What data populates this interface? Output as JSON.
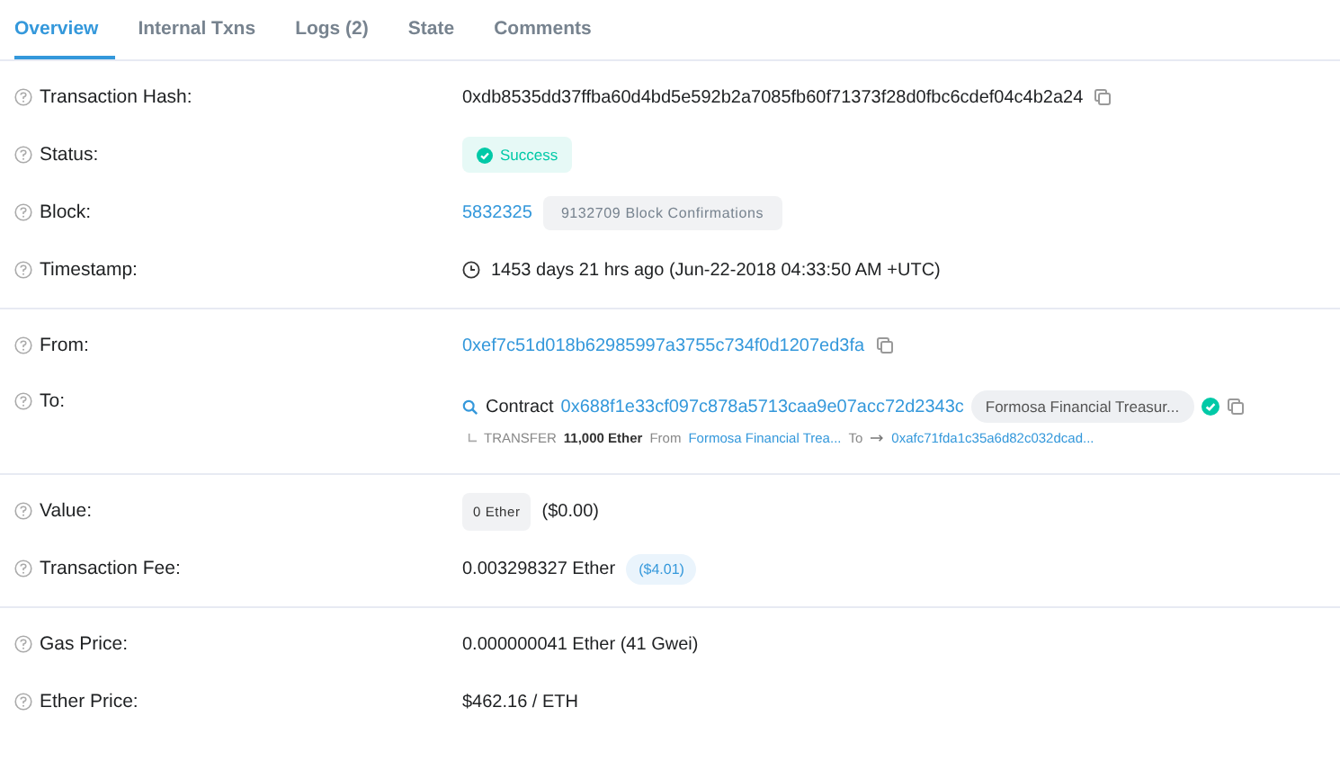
{
  "tabs": [
    {
      "label": "Overview",
      "selected": true
    },
    {
      "label": "Internal Txns",
      "selected": false
    },
    {
      "label": "Logs (2)",
      "selected": false
    },
    {
      "label": "State",
      "selected": false
    },
    {
      "label": "Comments",
      "selected": false
    }
  ],
  "sections": [
    {
      "rows": [
        {
          "kind": "hash",
          "label": "Transaction Hash:",
          "value": "0xdb8535dd37ffba60d4bd5e592b2a7085fb60f71373f28d0fbc6cdef04c4b2a24"
        },
        {
          "kind": "status",
          "label": "Status:",
          "value": "Success"
        },
        {
          "kind": "block",
          "label": "Block:",
          "value": "5832325",
          "badge": "9132709 Block Confirmations"
        },
        {
          "kind": "timestamp",
          "label": "Timestamp:",
          "value": "1453 days 21 hrs ago (Jun-22-2018 04:33:50 AM +UTC)"
        }
      ]
    },
    {
      "rows": [
        {
          "kind": "address",
          "label": "From:",
          "value": "0xef7c51d018b62985997a3755c734f0d1207ed3fa"
        },
        {
          "kind": "to",
          "label": "To:",
          "prefix": "Contract",
          "value": "0x688f1e33cf097c878a5713caa9e07acc72d2343c",
          "tag": "Formosa Financial Treasur...",
          "verified": true,
          "transfer": {
            "type": "TRANSFER",
            "amount": "11,000 Ether",
            "from_word": "From",
            "from": "Formosa Financial Trea...",
            "to_word": "To",
            "to": "0xafc71fda1c35a6d82c032dcad..."
          }
        }
      ]
    },
    {
      "rows": [
        {
          "kind": "value",
          "label": "Value:",
          "value": "0 Ether",
          "note": "($0.00)"
        },
        {
          "kind": "fee",
          "label": "Transaction Fee:",
          "value": "0.003298327 Ether",
          "note": "($4.01)"
        }
      ]
    },
    {
      "rows": [
        {
          "kind": "text",
          "label": "Gas Price:",
          "value": "0.000000041 Ether (41 Gwei)"
        },
        {
          "kind": "text",
          "label": "Ether Price:",
          "value": "$462.16 / ETH"
        }
      ]
    }
  ]
}
